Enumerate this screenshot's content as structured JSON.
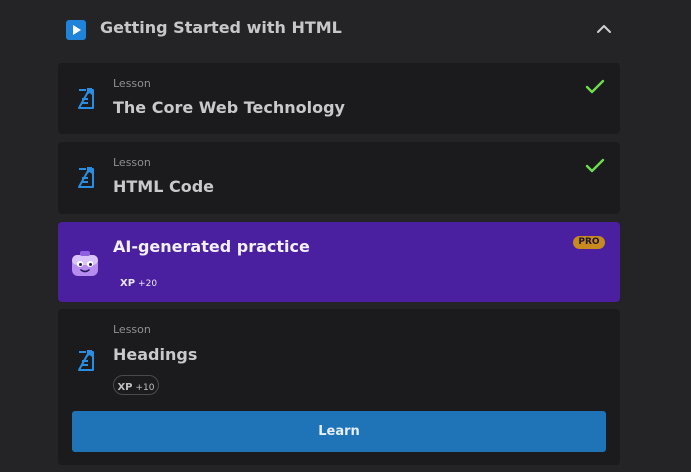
{
  "section": {
    "title": "Getting Started with HTML",
    "icon": "play-icon",
    "collapse_icon": "chevron-up-icon"
  },
  "lessons": [
    {
      "label": "Lesson",
      "title": "The Core Web Technology",
      "completed": true
    },
    {
      "label": "Lesson",
      "title": "HTML Code",
      "completed": true
    },
    {
      "label": "Lesson",
      "title": "Headings",
      "completed": false,
      "xp_tag": "XP",
      "xp_value": "+10"
    }
  ],
  "practice": {
    "title": "AI-generated practice",
    "badge": "PRO",
    "xp_tag": "XP",
    "xp_value": "+20",
    "icon": "robot-mascot-icon"
  },
  "learn_button": {
    "label": "Learn"
  },
  "colors": {
    "background": "#242426",
    "card": "#1b1b1d",
    "practice_card": "#4a1fa0",
    "accent_blue": "#1f84d9",
    "learn_button": "#1f74b8",
    "check_green": "#6fdc4f",
    "pro_badge": "#c78a1e"
  }
}
